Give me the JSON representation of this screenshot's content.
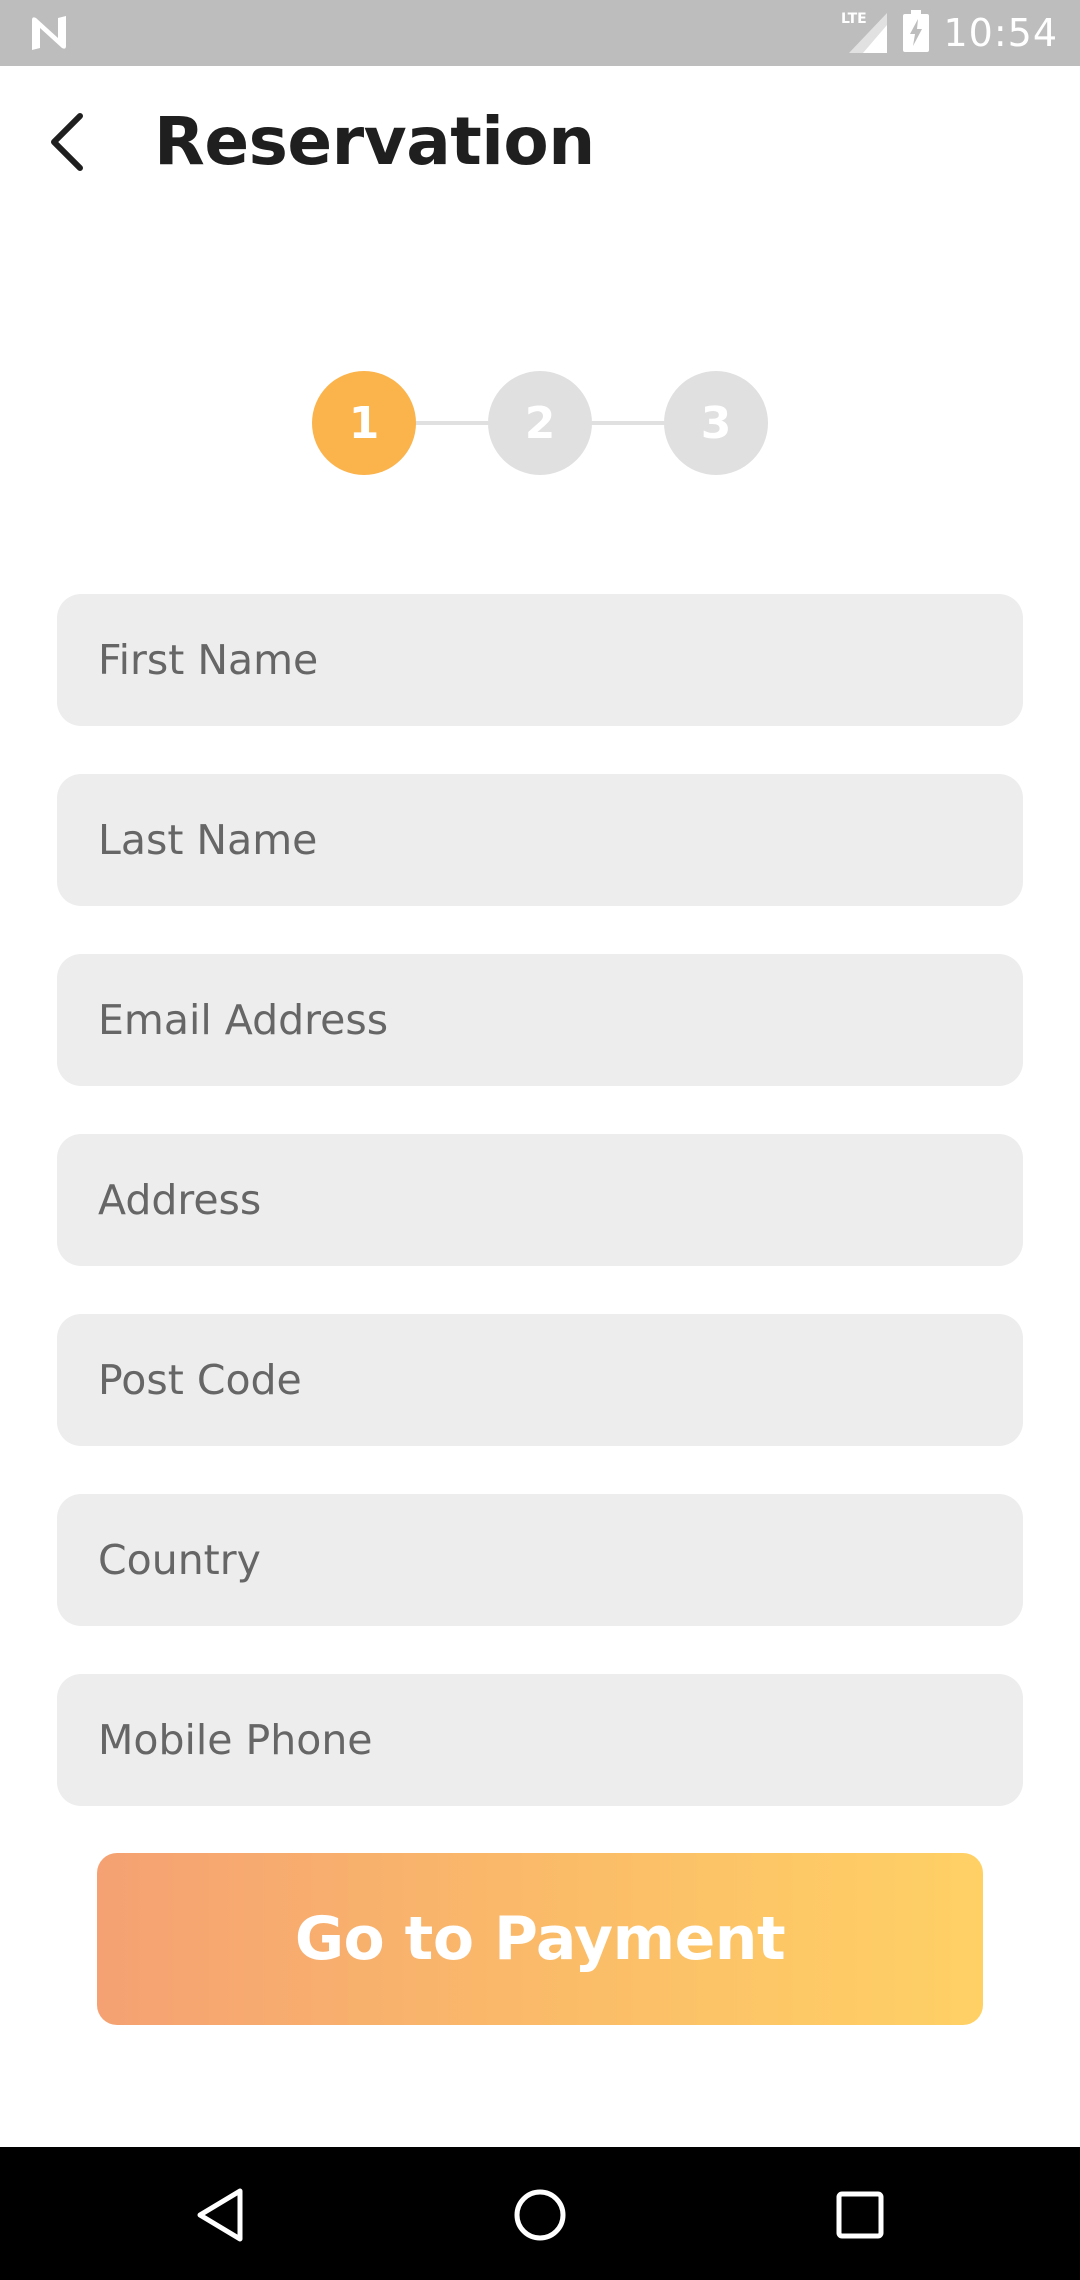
{
  "status_bar": {
    "time": "10:54",
    "network_label": "LTE",
    "icons": [
      "notification-n-icon",
      "lte-signal-icon",
      "battery-charging-icon"
    ]
  },
  "header": {
    "title": "Reservation",
    "back_icon": "chevron-left-icon"
  },
  "stepper": {
    "steps": [
      "1",
      "2",
      "3"
    ],
    "active_step": 1,
    "active_color": "#fbb34c",
    "inactive_color": "#e0e0e0"
  },
  "form": {
    "fields": [
      {
        "placeholder": "First Name",
        "value": ""
      },
      {
        "placeholder": "Last Name",
        "value": ""
      },
      {
        "placeholder": "Email Address",
        "value": ""
      },
      {
        "placeholder": "Address",
        "value": ""
      },
      {
        "placeholder": "Post Code",
        "value": ""
      },
      {
        "placeholder": "Country",
        "value": ""
      },
      {
        "placeholder": "Mobile Phone",
        "value": ""
      }
    ]
  },
  "actions": {
    "primary_label": "Go to Payment",
    "gradient_start": "#f5a173",
    "gradient_end": "#ffd165"
  },
  "nav_bar": {
    "icons": [
      "nav-back-icon",
      "nav-home-icon",
      "nav-recents-icon"
    ]
  }
}
